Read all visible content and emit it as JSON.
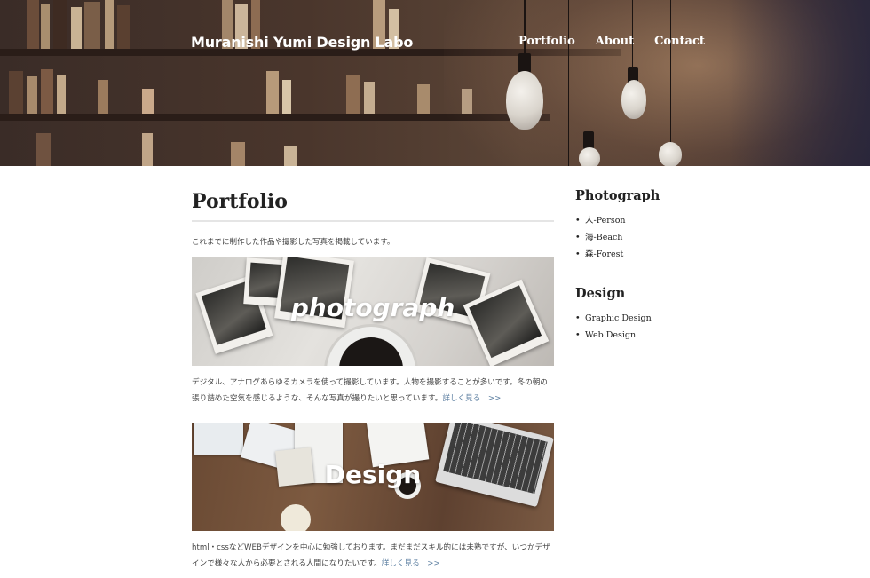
{
  "header": {
    "site_title": "Muranishi Yumi Design Labo",
    "nav": [
      "Portfolio",
      "About",
      "Contact"
    ]
  },
  "main": {
    "page_title": "Portfolio",
    "intro": "これまでに制作した作品や撮影した写真を掲載しています。",
    "cards": [
      {
        "image_label": "photograph",
        "description": "デジタル、アナログあらゆるカメラを使って撮影しています。人物を撮影することが多いです。冬の朝の張り詰めた空気を感じるような、そんな写真が撮りたいと思っています。",
        "more_link": "詳しく見る　>>"
      },
      {
        "image_label": "Design",
        "description": "html・cssなどWEBデザインを中心に勉強しております。まだまだスキル的には未熟ですが、いつかデザインで様々な人から必要とされる人間になりたいです。",
        "more_link": "詳しく見る　>>"
      }
    ]
  },
  "sidebar": {
    "photograph": {
      "heading": "Photograph",
      "items": [
        "人-Person",
        "海-Beach",
        "森-Forest"
      ]
    },
    "design": {
      "heading": "Design",
      "items": [
        "Graphic Design",
        "Web Design"
      ]
    }
  },
  "colors": {
    "link": "#5b7ea0",
    "heading": "#222222",
    "rule": "#e5e5e5"
  }
}
